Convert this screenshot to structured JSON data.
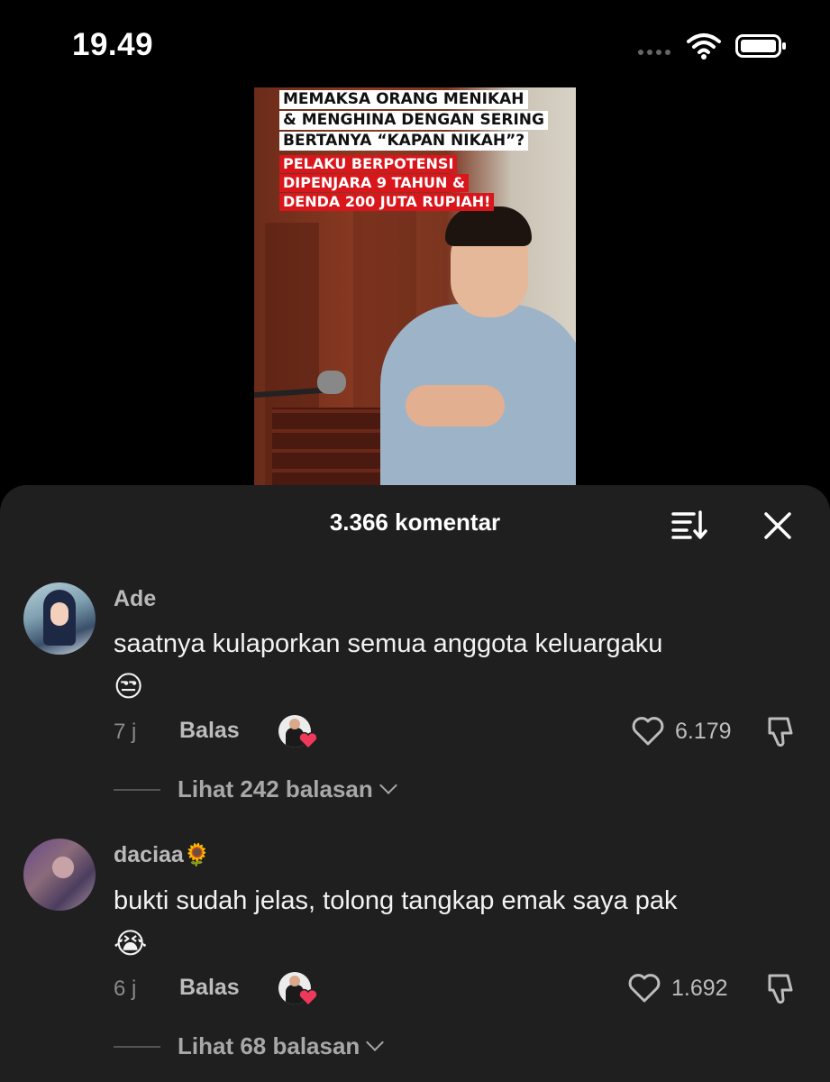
{
  "status_bar": {
    "time": "19.49"
  },
  "video": {
    "caption_lines": [
      "MEMAKSA ORANG MENIKAH",
      "& MENGHINA DENGAN SERING",
      "BERTANYA “KAPAN NIKAH”?"
    ],
    "highlight_lines": [
      "PELAKU BERPOTENSI",
      "DIPENJARA 9 TAHUN &",
      "DENDA 200 JUTA RUPIAH!"
    ],
    "caption_highlight_color": "#d8161b"
  },
  "comments_sheet": {
    "title": "3.366 komentar",
    "icons": [
      "sort-icon",
      "close-icon"
    ],
    "comments": [
      {
        "username": "Ade",
        "text": "saatnya kulaporkan semua anggota keluargaku",
        "emoji": "😒",
        "time": "7 j",
        "reply_label": "Balas",
        "likes": "6.179",
        "replies_label": "Lihat 242 balasan"
      },
      {
        "username": "daciaa",
        "username_emoji": "🌻",
        "text": "bukti sudah jelas, tolong tangkap emak saya pak",
        "emoji": "😭",
        "time": "6 j",
        "reply_label": "Balas",
        "likes": "1.692",
        "replies_label": "Lihat 68 balasan"
      }
    ]
  },
  "colors": {
    "sheet_background": "#1f1f1f",
    "creator_like_heart": "#f0385a"
  }
}
